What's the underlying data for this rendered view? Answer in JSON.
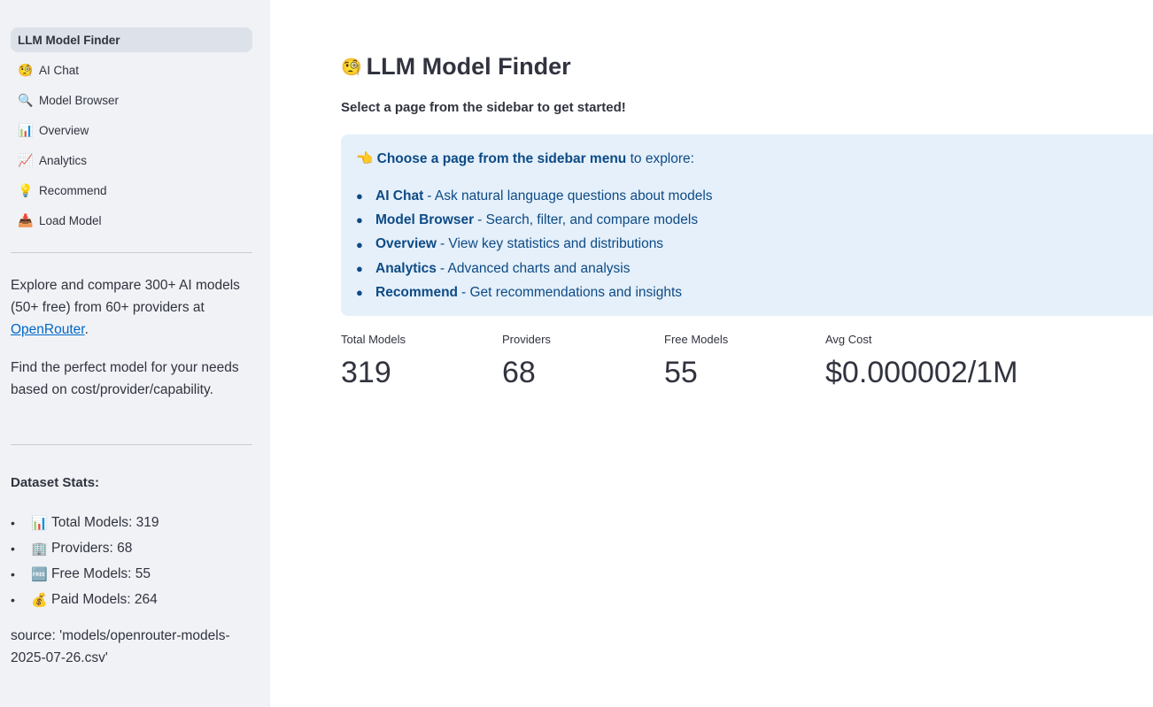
{
  "sidebar": {
    "nav": [
      {
        "label": "LLM Model Finder",
        "icon": "",
        "icon_name": "none",
        "active": true
      },
      {
        "label": "AI Chat",
        "icon": "🧐",
        "icon_name": "ai-chat-icon"
      },
      {
        "label": "Model Browser",
        "icon": "🔍",
        "icon_name": "magnifier-icon"
      },
      {
        "label": "Overview",
        "icon": "📊",
        "icon_name": "bar-chart-icon"
      },
      {
        "label": "Analytics",
        "icon": "📈",
        "icon_name": "trend-chart-icon"
      },
      {
        "label": "Recommend",
        "icon": "💡",
        "icon_name": "light-bulb-icon"
      },
      {
        "label": "Load Model",
        "icon": "📥",
        "icon_name": "inbox-tray-icon"
      }
    ],
    "intro_prefix": "Explore and compare 300+ AI models (50+ free) from 60+ providers at ",
    "intro_link": "OpenRouter",
    "intro_suffix": ".",
    "find_text": "Find the perfect model for your needs based on cost/provider/capability.",
    "stats_title": "Dataset Stats:",
    "stats": [
      {
        "icon": "📊",
        "icon_name": "bar-chart-icon",
        "text": "Total Models: 319"
      },
      {
        "icon": "🏢",
        "icon_name": "office-building-icon",
        "text": "Providers: 68"
      },
      {
        "icon": "🆓",
        "icon_name": "free-icon",
        "text": "Free Models: 55"
      },
      {
        "icon": "💰",
        "icon_name": "money-bag-icon",
        "text": "Paid Models: 264"
      }
    ],
    "source": "source: 'models/openrouter-models-2025-07-26.csv'"
  },
  "main": {
    "title_icon": "🧐",
    "title": "LLM Model Finder",
    "subtitle": "Select a page from the sidebar to get started!",
    "info": {
      "head_icon": "👈",
      "head_bold": "Choose a page from the sidebar menu",
      "head_rest": " to explore:",
      "items": [
        {
          "bold": "AI Chat",
          "rest": "- Ask natural language questions about models"
        },
        {
          "bold": "Model Browser",
          "rest": "- Search, filter, and compare models"
        },
        {
          "bold": "Overview",
          "rest": "- View key statistics and distributions"
        },
        {
          "bold": "Analytics",
          "rest": "- Advanced charts and analysis"
        },
        {
          "bold": "Recommend",
          "rest": "- Get recommendations and insights"
        }
      ]
    },
    "metrics": [
      {
        "label": "Total Models",
        "value": "319"
      },
      {
        "label": "Providers",
        "value": "68"
      },
      {
        "label": "Free Models",
        "value": "55"
      },
      {
        "label": "Avg Cost",
        "value": "$0.000002/1M"
      }
    ]
  },
  "colors": {
    "sidebar_bg": "#f0f2f6",
    "active_nav_bg": "#dde1ea",
    "info_bg": "#e5f0fa",
    "info_text": "#0d4a85",
    "link": "#0068c9",
    "text": "#31333f"
  }
}
